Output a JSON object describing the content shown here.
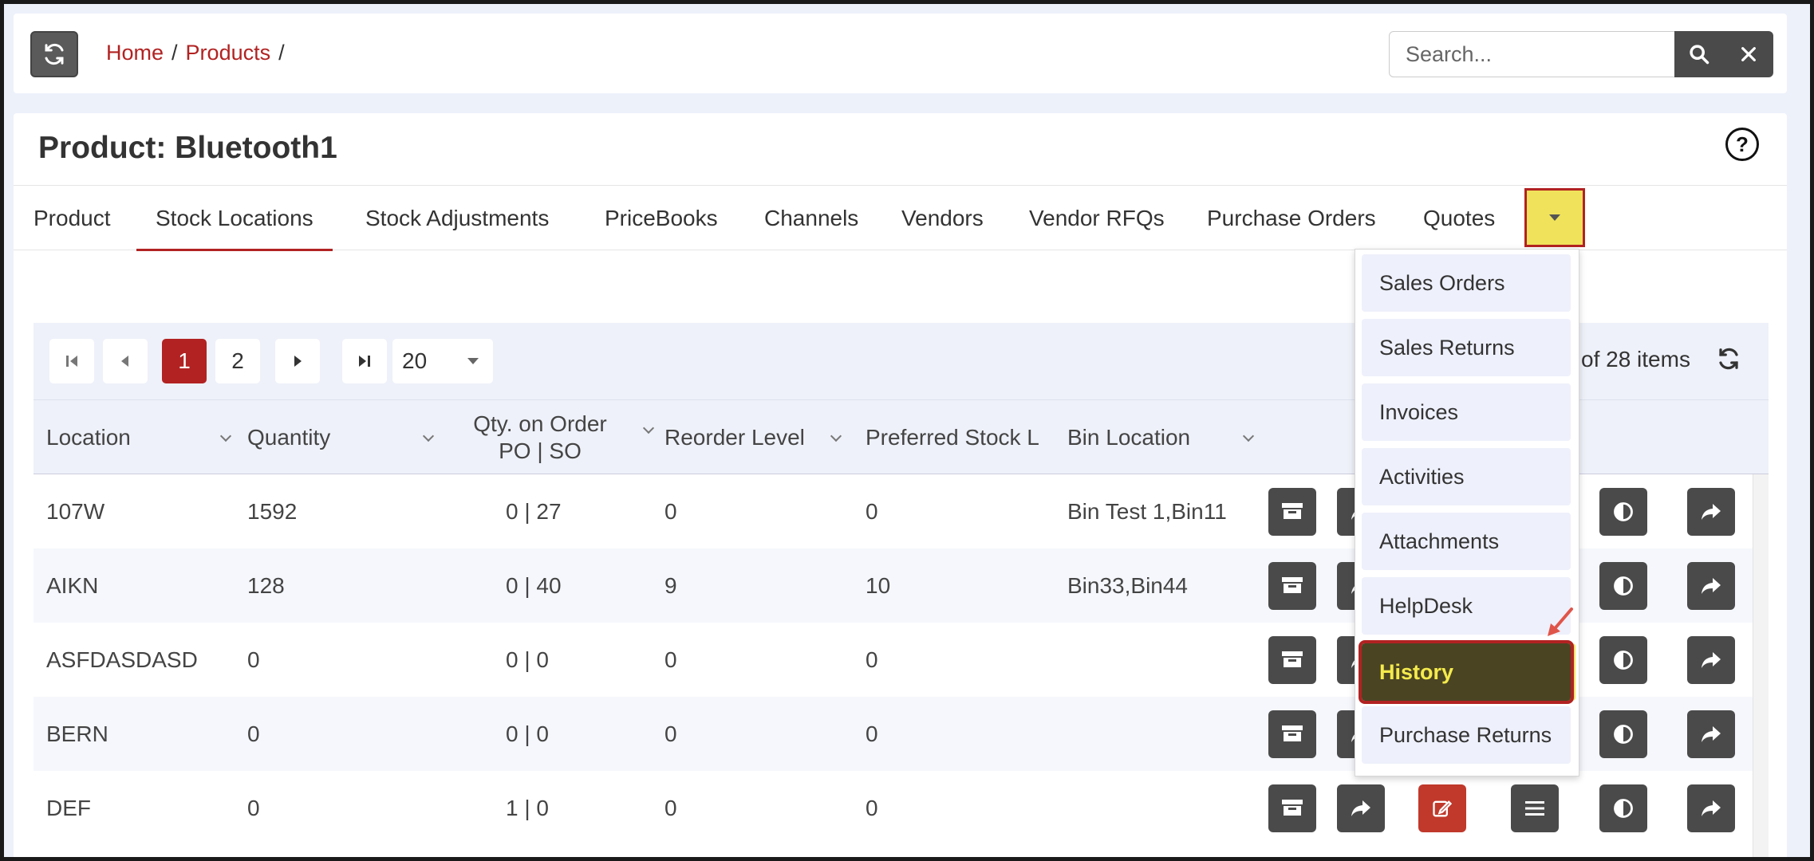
{
  "breadcrumb": {
    "home": "Home",
    "products": "Products",
    "separator": "/"
  },
  "search": {
    "placeholder": "Search..."
  },
  "page": {
    "title": "Product: Bluetooth1",
    "help": "?"
  },
  "tabs": [
    {
      "label": "Product"
    },
    {
      "label": "Stock Locations",
      "active": true
    },
    {
      "label": "Stock Adjustments"
    },
    {
      "label": "PriceBooks"
    },
    {
      "label": "Channels"
    },
    {
      "label": "Vendors"
    },
    {
      "label": "Vendor RFQs"
    },
    {
      "label": "Purchase Orders"
    },
    {
      "label": "Quotes"
    }
  ],
  "dropdown": {
    "items": [
      {
        "label": "Sales Orders"
      },
      {
        "label": "Sales Returns"
      },
      {
        "label": "Invoices"
      },
      {
        "label": "Activities"
      },
      {
        "label": "Attachments"
      },
      {
        "label": "HelpDesk"
      },
      {
        "label": "History",
        "highlighted": true
      },
      {
        "label": "Purchase Returns"
      }
    ]
  },
  "pager": {
    "pages": [
      "1",
      "2"
    ],
    "current": "1",
    "page_size": "20",
    "info": "of 28 items"
  },
  "columns": {
    "location": "Location",
    "quantity": "Quantity",
    "qty_on_order_line1": "Qty. on Order",
    "qty_on_order_line2": "PO | SO",
    "reorder_level": "Reorder Level",
    "preferred_stock": "Preferred Stock L",
    "bin_location": "Bin Location"
  },
  "rows": [
    {
      "location": "107W",
      "quantity": "1592",
      "qty_on_order": "0 | 27",
      "reorder": "0",
      "preferred": "0",
      "bin": "Bin Test 1,Bin11"
    },
    {
      "location": "AIKN",
      "quantity": "128",
      "qty_on_order": "0 | 40",
      "reorder": "9",
      "preferred": "10",
      "bin": "Bin33,Bin44"
    },
    {
      "location": "ASFDASDASD",
      "quantity": "0",
      "qty_on_order": "0 | 0",
      "reorder": "0",
      "preferred": "0",
      "bin": ""
    },
    {
      "location": "BERN",
      "quantity": "0",
      "qty_on_order": "0 | 0",
      "reorder": "0",
      "preferred": "0",
      "bin": ""
    },
    {
      "location": "DEF",
      "quantity": "0",
      "qty_on_order": "1 | 0",
      "reorder": "0",
      "preferred": "0",
      "bin": ""
    }
  ],
  "icons": {
    "refresh": "refresh-icon",
    "search": "search-icon",
    "close": "close-icon",
    "row_actions": [
      "stock-icon",
      "share-icon",
      "edit-icon",
      "menu-icon",
      "contrast-icon",
      "forward-icon"
    ]
  },
  "colors": {
    "accent": "#b22222",
    "highlight": "#f0e35b",
    "dark_button": "#4a4a4a"
  }
}
